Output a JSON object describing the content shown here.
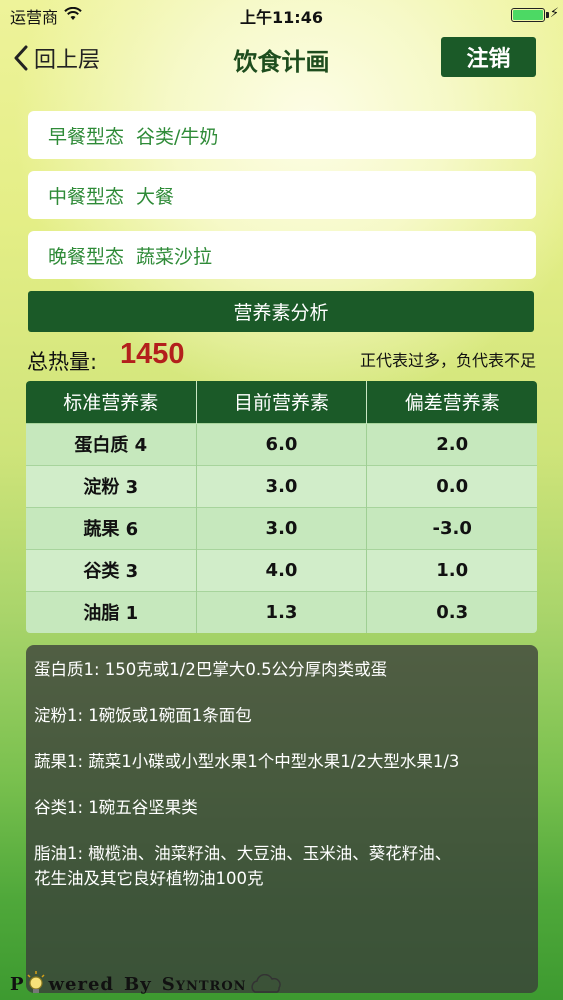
{
  "status_bar": {
    "carrier": "运营商",
    "time": "上午11:46"
  },
  "nav": {
    "back_label": "回上层",
    "title": "饮食计画",
    "logout_label": "注销"
  },
  "meals": [
    {
      "label": "早餐型态",
      "value": "谷类/牛奶"
    },
    {
      "label": "中餐型态",
      "value": "大餐"
    },
    {
      "label": "晚餐型态",
      "value": "蔬菜沙拉"
    }
  ],
  "analyze_label": "营养素分析",
  "total": {
    "label": "总热量:",
    "value": "1450",
    "note": "正代表过多，负代表不足"
  },
  "table": {
    "headers": [
      "标准营养素",
      "目前营养素",
      "偏差营养素"
    ],
    "rows": [
      [
        "蛋白质 4",
        "6.0",
        "2.0"
      ],
      [
        "淀粉 3",
        "3.0",
        "0.0"
      ],
      [
        "蔬果 6",
        "3.0",
        "-3.0"
      ],
      [
        "谷类 3",
        "4.0",
        "1.0"
      ],
      [
        "油脂 1",
        "1.3",
        "0.3"
      ]
    ]
  },
  "notes": [
    "蛋白质1:  150克或1/2巴掌大0.5公分厚肉类或蛋",
    "淀粉1:  1碗饭或1碗面1条面包",
    "蔬果1:  蔬菜1小碟或小型水果1个中型水果1/2大型水果1/3",
    "谷类1:  1碗五谷坚果类",
    "脂油1:  橄榄油、油菜籽油、大豆油、玉米油、葵花籽油、",
    "花生油及其它良好植物油100克"
  ],
  "footer": {
    "p": "P",
    "wered": "wered",
    "by": "By",
    "brand": "Syntron"
  },
  "colors": {
    "primary_green": "#1b5a28",
    "meal_text": "#2f8b38",
    "total_red": "#b3201c",
    "table_row": "#c6e8bd"
  }
}
